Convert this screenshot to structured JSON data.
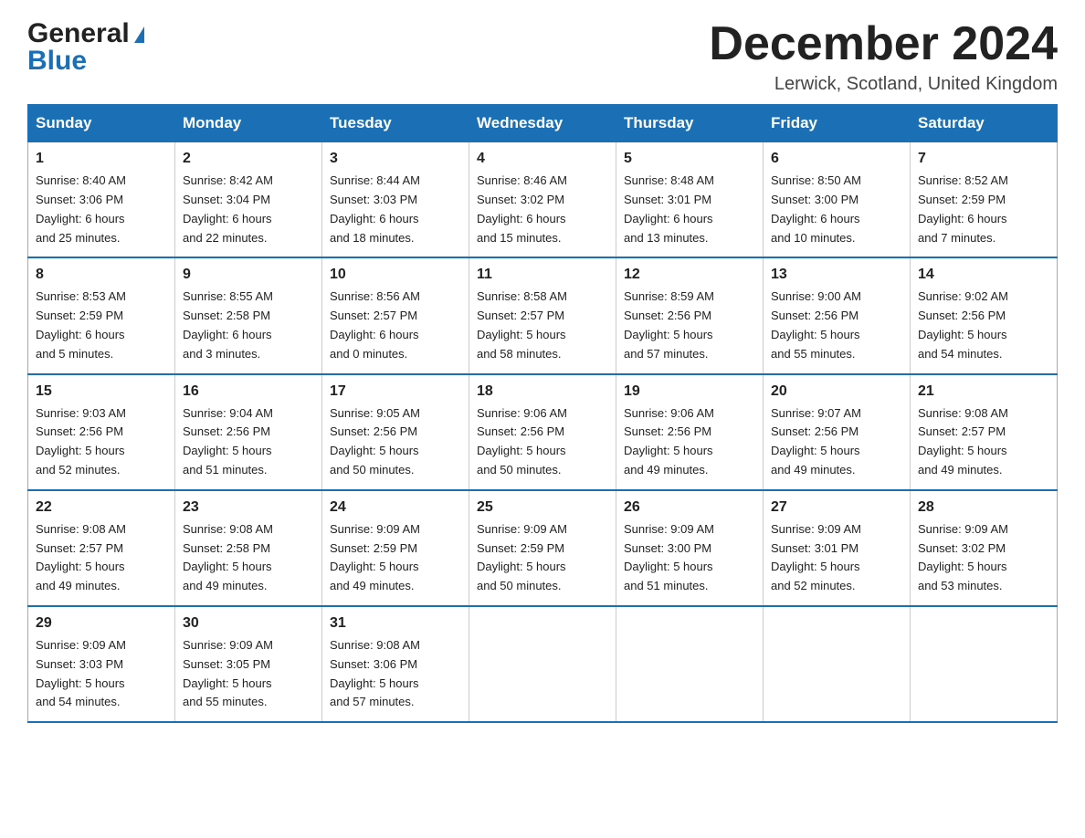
{
  "logo": {
    "general": "General",
    "blue": "Blue"
  },
  "title": "December 2024",
  "location": "Lerwick, Scotland, United Kingdom",
  "days_of_week": [
    "Sunday",
    "Monday",
    "Tuesday",
    "Wednesday",
    "Thursday",
    "Friday",
    "Saturday"
  ],
  "weeks": [
    [
      {
        "day": "1",
        "sunrise": "Sunrise: 8:40 AM",
        "sunset": "Sunset: 3:06 PM",
        "daylight": "Daylight: 6 hours",
        "daylight2": "and 25 minutes."
      },
      {
        "day": "2",
        "sunrise": "Sunrise: 8:42 AM",
        "sunset": "Sunset: 3:04 PM",
        "daylight": "Daylight: 6 hours",
        "daylight2": "and 22 minutes."
      },
      {
        "day": "3",
        "sunrise": "Sunrise: 8:44 AM",
        "sunset": "Sunset: 3:03 PM",
        "daylight": "Daylight: 6 hours",
        "daylight2": "and 18 minutes."
      },
      {
        "day": "4",
        "sunrise": "Sunrise: 8:46 AM",
        "sunset": "Sunset: 3:02 PM",
        "daylight": "Daylight: 6 hours",
        "daylight2": "and 15 minutes."
      },
      {
        "day": "5",
        "sunrise": "Sunrise: 8:48 AM",
        "sunset": "Sunset: 3:01 PM",
        "daylight": "Daylight: 6 hours",
        "daylight2": "and 13 minutes."
      },
      {
        "day": "6",
        "sunrise": "Sunrise: 8:50 AM",
        "sunset": "Sunset: 3:00 PM",
        "daylight": "Daylight: 6 hours",
        "daylight2": "and 10 minutes."
      },
      {
        "day": "7",
        "sunrise": "Sunrise: 8:52 AM",
        "sunset": "Sunset: 2:59 PM",
        "daylight": "Daylight: 6 hours",
        "daylight2": "and 7 minutes."
      }
    ],
    [
      {
        "day": "8",
        "sunrise": "Sunrise: 8:53 AM",
        "sunset": "Sunset: 2:59 PM",
        "daylight": "Daylight: 6 hours",
        "daylight2": "and 5 minutes."
      },
      {
        "day": "9",
        "sunrise": "Sunrise: 8:55 AM",
        "sunset": "Sunset: 2:58 PM",
        "daylight": "Daylight: 6 hours",
        "daylight2": "and 3 minutes."
      },
      {
        "day": "10",
        "sunrise": "Sunrise: 8:56 AM",
        "sunset": "Sunset: 2:57 PM",
        "daylight": "Daylight: 6 hours",
        "daylight2": "and 0 minutes."
      },
      {
        "day": "11",
        "sunrise": "Sunrise: 8:58 AM",
        "sunset": "Sunset: 2:57 PM",
        "daylight": "Daylight: 5 hours",
        "daylight2": "and 58 minutes."
      },
      {
        "day": "12",
        "sunrise": "Sunrise: 8:59 AM",
        "sunset": "Sunset: 2:56 PM",
        "daylight": "Daylight: 5 hours",
        "daylight2": "and 57 minutes."
      },
      {
        "day": "13",
        "sunrise": "Sunrise: 9:00 AM",
        "sunset": "Sunset: 2:56 PM",
        "daylight": "Daylight: 5 hours",
        "daylight2": "and 55 minutes."
      },
      {
        "day": "14",
        "sunrise": "Sunrise: 9:02 AM",
        "sunset": "Sunset: 2:56 PM",
        "daylight": "Daylight: 5 hours",
        "daylight2": "and 54 minutes."
      }
    ],
    [
      {
        "day": "15",
        "sunrise": "Sunrise: 9:03 AM",
        "sunset": "Sunset: 2:56 PM",
        "daylight": "Daylight: 5 hours",
        "daylight2": "and 52 minutes."
      },
      {
        "day": "16",
        "sunrise": "Sunrise: 9:04 AM",
        "sunset": "Sunset: 2:56 PM",
        "daylight": "Daylight: 5 hours",
        "daylight2": "and 51 minutes."
      },
      {
        "day": "17",
        "sunrise": "Sunrise: 9:05 AM",
        "sunset": "Sunset: 2:56 PM",
        "daylight": "Daylight: 5 hours",
        "daylight2": "and 50 minutes."
      },
      {
        "day": "18",
        "sunrise": "Sunrise: 9:06 AM",
        "sunset": "Sunset: 2:56 PM",
        "daylight": "Daylight: 5 hours",
        "daylight2": "and 50 minutes."
      },
      {
        "day": "19",
        "sunrise": "Sunrise: 9:06 AM",
        "sunset": "Sunset: 2:56 PM",
        "daylight": "Daylight: 5 hours",
        "daylight2": "and 49 minutes."
      },
      {
        "day": "20",
        "sunrise": "Sunrise: 9:07 AM",
        "sunset": "Sunset: 2:56 PM",
        "daylight": "Daylight: 5 hours",
        "daylight2": "and 49 minutes."
      },
      {
        "day": "21",
        "sunrise": "Sunrise: 9:08 AM",
        "sunset": "Sunset: 2:57 PM",
        "daylight": "Daylight: 5 hours",
        "daylight2": "and 49 minutes."
      }
    ],
    [
      {
        "day": "22",
        "sunrise": "Sunrise: 9:08 AM",
        "sunset": "Sunset: 2:57 PM",
        "daylight": "Daylight: 5 hours",
        "daylight2": "and 49 minutes."
      },
      {
        "day": "23",
        "sunrise": "Sunrise: 9:08 AM",
        "sunset": "Sunset: 2:58 PM",
        "daylight": "Daylight: 5 hours",
        "daylight2": "and 49 minutes."
      },
      {
        "day": "24",
        "sunrise": "Sunrise: 9:09 AM",
        "sunset": "Sunset: 2:59 PM",
        "daylight": "Daylight: 5 hours",
        "daylight2": "and 49 minutes."
      },
      {
        "day": "25",
        "sunrise": "Sunrise: 9:09 AM",
        "sunset": "Sunset: 2:59 PM",
        "daylight": "Daylight: 5 hours",
        "daylight2": "and 50 minutes."
      },
      {
        "day": "26",
        "sunrise": "Sunrise: 9:09 AM",
        "sunset": "Sunset: 3:00 PM",
        "daylight": "Daylight: 5 hours",
        "daylight2": "and 51 minutes."
      },
      {
        "day": "27",
        "sunrise": "Sunrise: 9:09 AM",
        "sunset": "Sunset: 3:01 PM",
        "daylight": "Daylight: 5 hours",
        "daylight2": "and 52 minutes."
      },
      {
        "day": "28",
        "sunrise": "Sunrise: 9:09 AM",
        "sunset": "Sunset: 3:02 PM",
        "daylight": "Daylight: 5 hours",
        "daylight2": "and 53 minutes."
      }
    ],
    [
      {
        "day": "29",
        "sunrise": "Sunrise: 9:09 AM",
        "sunset": "Sunset: 3:03 PM",
        "daylight": "Daylight: 5 hours",
        "daylight2": "and 54 minutes."
      },
      {
        "day": "30",
        "sunrise": "Sunrise: 9:09 AM",
        "sunset": "Sunset: 3:05 PM",
        "daylight": "Daylight: 5 hours",
        "daylight2": "and 55 minutes."
      },
      {
        "day": "31",
        "sunrise": "Sunrise: 9:08 AM",
        "sunset": "Sunset: 3:06 PM",
        "daylight": "Daylight: 5 hours",
        "daylight2": "and 57 minutes."
      },
      {
        "day": "",
        "sunrise": "",
        "sunset": "",
        "daylight": "",
        "daylight2": ""
      },
      {
        "day": "",
        "sunrise": "",
        "sunset": "",
        "daylight": "",
        "daylight2": ""
      },
      {
        "day": "",
        "sunrise": "",
        "sunset": "",
        "daylight": "",
        "daylight2": ""
      },
      {
        "day": "",
        "sunrise": "",
        "sunset": "",
        "daylight": "",
        "daylight2": ""
      }
    ]
  ]
}
